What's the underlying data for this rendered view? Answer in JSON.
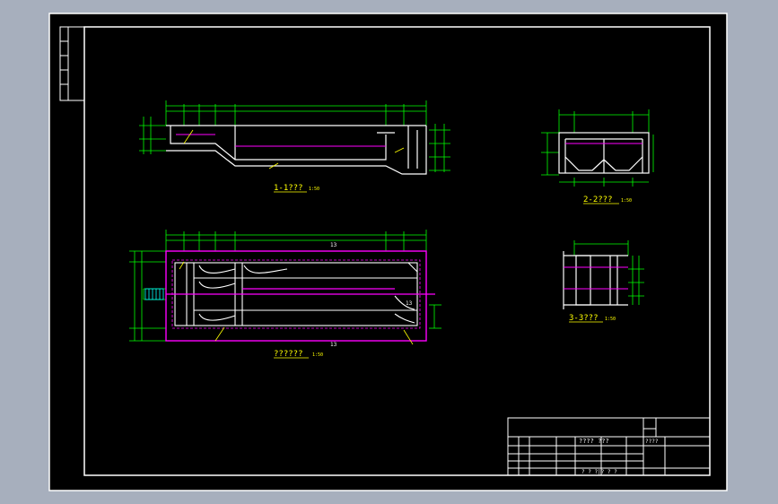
{
  "colors": {
    "background": "#a7afbd",
    "paper": "#000000",
    "border": "#ffffff",
    "outline": "#ffffff",
    "dimension": "#00ff00",
    "annotation": "#ffff00",
    "highlight": "#ff00ff",
    "accent": "#00ffff"
  },
  "views": {
    "section_1": {
      "title": "1-1???",
      "scale": "1:50"
    },
    "section_2": {
      "title": "2-2???",
      "scale": "1:50"
    },
    "section_3": {
      "title": "3-3???",
      "scale": "1:50"
    },
    "plan": {
      "title": "??????",
      "scale": "1:50",
      "mark_top": "13",
      "mark_bottom": "13",
      "mark_right": "13"
    }
  },
  "title_block": {
    "drawing_name": "????  ???",
    "label_right": "????",
    "label_bottom": "?  ?  ?|?  ?  ?"
  }
}
